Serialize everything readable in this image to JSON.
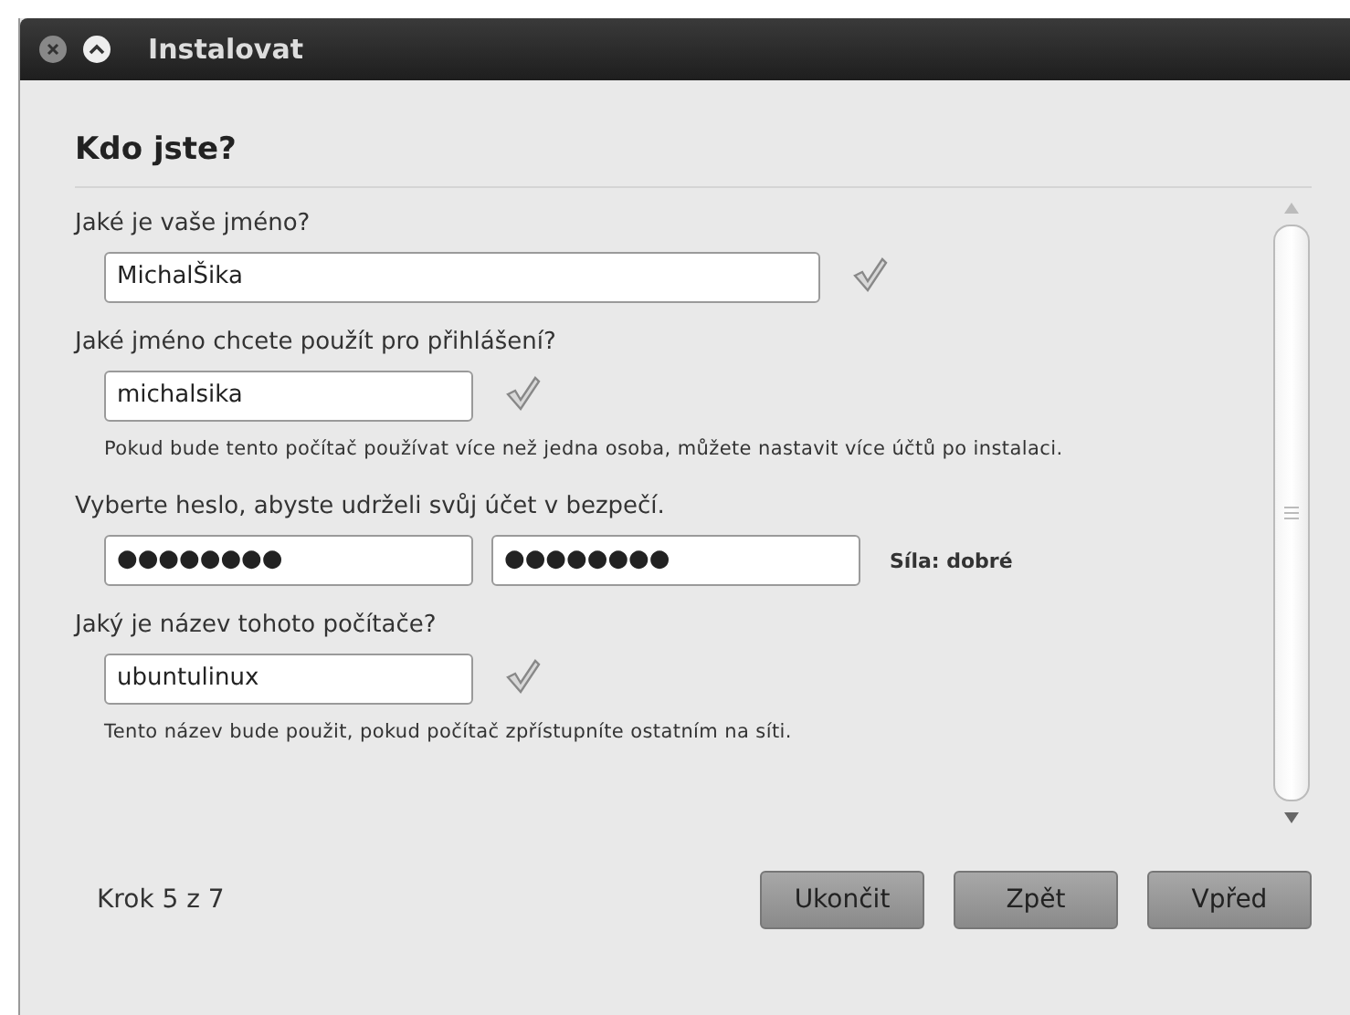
{
  "window": {
    "title": "Instalovat"
  },
  "heading": "Kdo jste?",
  "sections": [
    {
      "kind": "name",
      "label": "Jaké je vaše jméno?",
      "value": "MichalŠika",
      "valid": true
    },
    {
      "kind": "login",
      "label": "Jaké jméno chcete použít pro přihlášení?",
      "value": "michalsika",
      "valid": true,
      "help": "Pokud bude tento počítač používat více než jedna osoba, můžete nastavit více účtů po instalaci."
    },
    {
      "kind": "password",
      "label": "Vyberte heslo, abyste udrželi svůj účet v bezpečí.",
      "value": "●●●●●●●●",
      "confirm": "●●●●●●●●",
      "strength": "Síla: dobré"
    },
    {
      "kind": "computer",
      "label": "Jaký je název tohoto počítače?",
      "value": "ubuntulinux",
      "valid": true,
      "help": "Tento název bude použit, pokud počítač zpřístupníte ostatním na síti."
    }
  ],
  "step": "Krok 5 z 7",
  "buttons": [
    "Ukončit",
    "Zpět",
    "Vpřed"
  ]
}
